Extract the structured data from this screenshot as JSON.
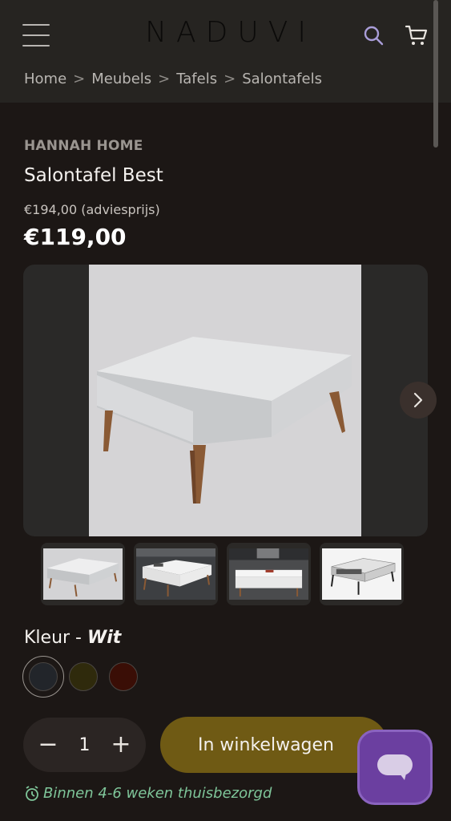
{
  "header": {
    "logo": "NADUVI",
    "menu_icon": "hamburger-menu-icon",
    "search_icon": "search-icon",
    "cart_icon": "cart-icon"
  },
  "breadcrumb": {
    "items": [
      "Home",
      "Meubels",
      "Tafels",
      "Salontafels"
    ],
    "separator": ">"
  },
  "product": {
    "brand": "HANNAH HOME",
    "title": "Salontafel Best",
    "old_price": "€194,00 (adviesprijs)",
    "price": "€119,00"
  },
  "gallery": {
    "next_icon": "chevron-right-icon",
    "thumbnail_count": 4
  },
  "color": {
    "label": "Kleur -",
    "selected": "Wit",
    "swatches": [
      "#22252a",
      "#2f2a0c",
      "#3a0e06"
    ],
    "selected_index": 0
  },
  "cart": {
    "decrement": "−",
    "quantity": "1",
    "increment": "+",
    "add_label": "In winkelwagen"
  },
  "delivery": {
    "icon": "alarm-clock-icon",
    "text": "Binnen 4-6 weken thuisbezorgd"
  },
  "colors": {
    "accent": "#6f5a14",
    "chat": "#6b3fa0",
    "delivery_text": "#7fc69a"
  },
  "chat": {
    "icon": "chat-bubble-icon"
  }
}
